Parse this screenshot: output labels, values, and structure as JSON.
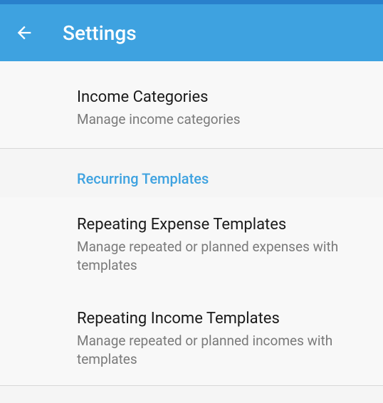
{
  "header": {
    "title": "Settings"
  },
  "items": {
    "income_categories": {
      "title": "Income Categories",
      "subtitle": "Manage income categories"
    },
    "recurring_templates_header": "Recurring Templates",
    "repeating_expense": {
      "title": "Repeating Expense Templates",
      "subtitle": "Manage repeated or planned expenses with templates"
    },
    "repeating_income": {
      "title": "Repeating Income Templates",
      "subtitle": "Manage repeated or planned incomes with templates"
    }
  }
}
